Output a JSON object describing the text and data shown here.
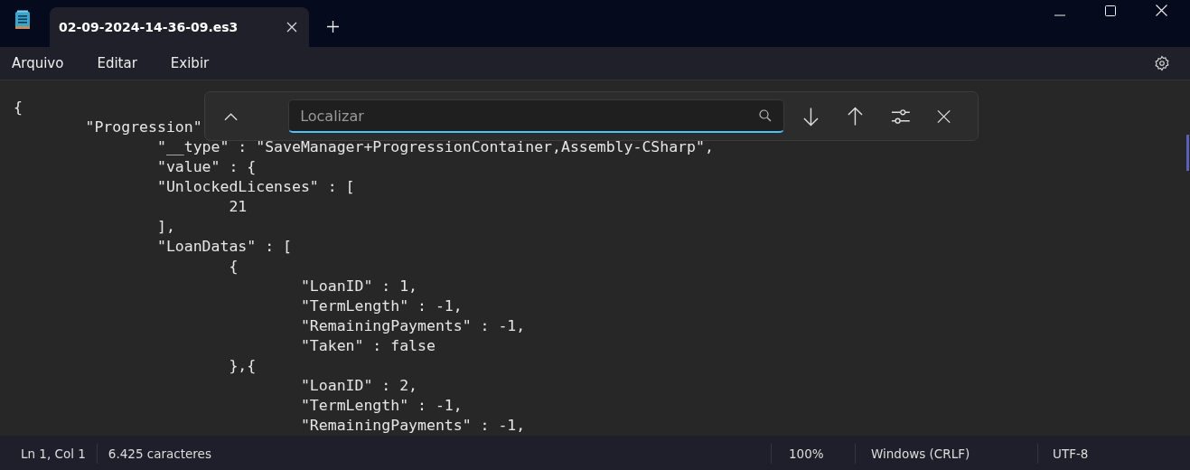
{
  "tabs": [
    {
      "title": "02-09-2024-14-36-09.es3",
      "selected": true
    }
  ],
  "menu": [
    "Arquivo",
    "Editar",
    "Exibir"
  ],
  "lines": [
    "{",
    "\t\"Progression\"",
    "\t\t\"__type\" : \"SaveManager+ProgressionContainer,Assembly-CSharp\",",
    "\t\t\"value\" : {",
    "\t\t\"UnlockedLicenses\" : [",
    "\t\t\t21",
    "\t\t],",
    "\t\t\"LoanDatas\" : [",
    "\t\t\t{",
    "\t\t\t\t\"LoanID\" : 1,",
    "\t\t\t\t\"TermLength\" : -1,",
    "\t\t\t\t\"RemainingPayments\" : -1,",
    "\t\t\t\t\"Taken\" : false",
    "\t\t\t},{",
    "\t\t\t\t\"LoanID\" : 2,",
    "\t\t\t\t\"TermLength\" : -1,",
    "\t\t\t\t\"RemainingPayments\" : -1,"
  ],
  "find": {
    "placeholder": "Localizar"
  },
  "status": {
    "position": "Ln 1, Col 1",
    "count": "6.425 caracteres",
    "zoom": "100%",
    "line_endings": "Windows (CRLF)",
    "encoding": "UTF-8"
  }
}
